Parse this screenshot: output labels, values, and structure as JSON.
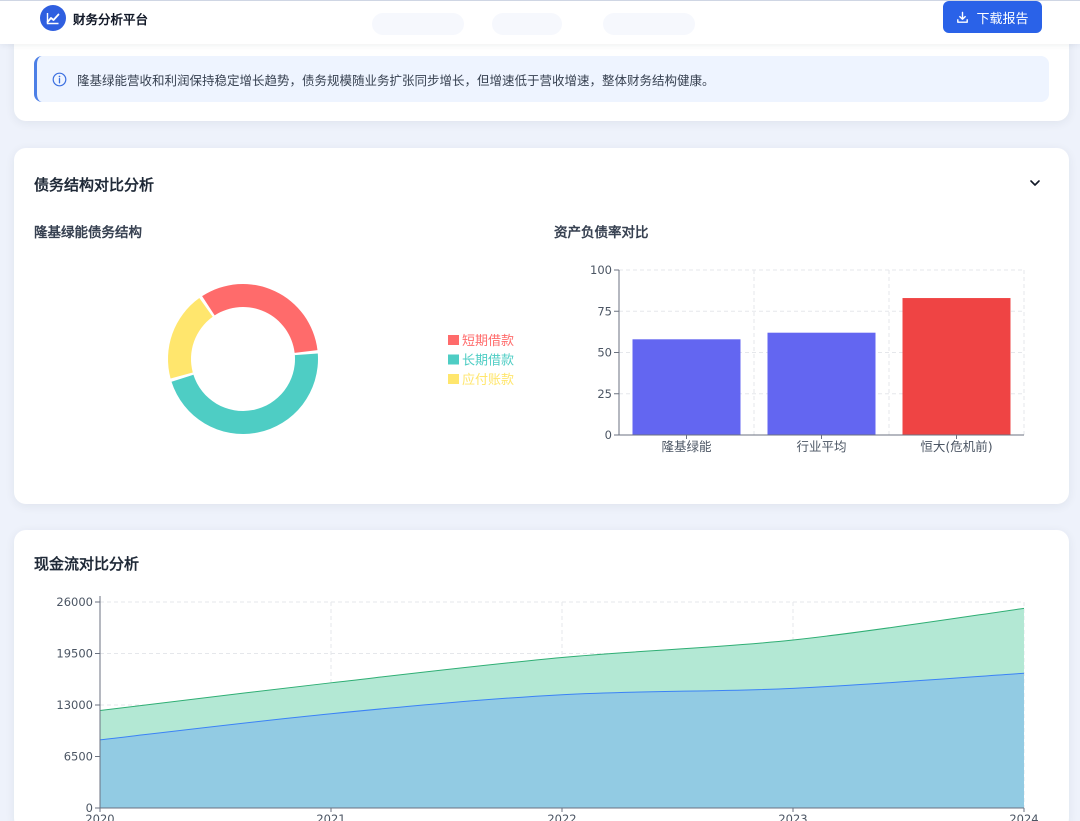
{
  "header": {
    "brand_name": "财务分析平台",
    "download_label": "下载报告"
  },
  "notice": {
    "text": "隆基绿能营收和利润保持稳定增长趋势，债务规模随业务扩张同步增长，但增速低于营收增速，整体财务结构健康。"
  },
  "debt_section": {
    "title": "债务结构对比分析",
    "left_title": "隆基绿能债务结构",
    "right_title": "资产负债率对比"
  },
  "cashflow_section": {
    "title": "现金流对比分析"
  },
  "colors": {
    "accent": "#2a62e8",
    "short_term": "#ff6b6b",
    "long_term": "#4ecdc4",
    "payable": "#ffe66d",
    "bar_company": "#6366f1",
    "bar_danger": "#ef4444",
    "area_upper": "#b3e8d4",
    "area_lower": "#92cbe3"
  },
  "chart_data": [
    {
      "type": "pie",
      "variant": "donut",
      "labels": [
        "短期借款",
        "长期借款",
        "应付账款"
      ],
      "values": [
        33,
        47,
        20
      ],
      "legend": "right"
    },
    {
      "type": "bar",
      "categories": [
        "隆基绿能",
        "行业平均",
        "恒大(危机前)"
      ],
      "values": [
        58,
        62,
        83
      ],
      "ylim": [
        0,
        100
      ],
      "yticks": [
        0,
        25,
        50,
        75,
        100
      ],
      "grid": true
    },
    {
      "type": "area",
      "stacked": true,
      "x": [
        "2020",
        "2021",
        "2022",
        "2023",
        "2024"
      ],
      "series": [
        {
          "values": [
            8600,
            11900,
            14300,
            15100,
            17000
          ]
        },
        {
          "values": [
            3700,
            3900,
            4700,
            6100,
            8200
          ]
        }
      ],
      "ylim": [
        0,
        26000
      ],
      "yticks": [
        0,
        6500,
        13000,
        19500,
        26000
      ],
      "grid": true
    }
  ]
}
